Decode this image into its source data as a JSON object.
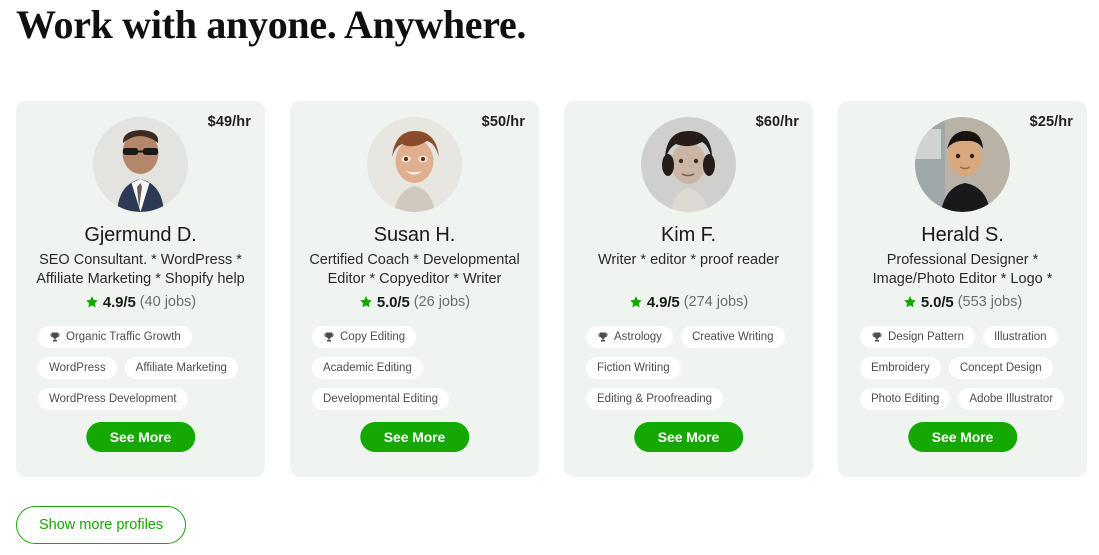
{
  "heading": "Work with anyone. Anywhere.",
  "colors": {
    "accent_green": "#14a800",
    "star_green": "#14a800",
    "card_bg": "#f0f4f0",
    "tag_bg": "#ffffff",
    "text_dark": "#1a1a1a",
    "text_muted": "#6b6f6b"
  },
  "see_more_label": "See More",
  "show_more_label": "Show more profiles",
  "trophy_icon": "trophy-icon",
  "star_icon": "star-icon",
  "cards": [
    {
      "rate": "$49/hr",
      "name": "Gjermund D.",
      "description": "SEO Consultant. * WordPress * Affiliate Marketing * Shopify help",
      "rating": "4.9/5",
      "jobs": "(40 jobs)",
      "avatar": "avatar-gjermund",
      "tag_rows": [
        [
          "Organic Traffic Growth"
        ],
        [
          "WordPress",
          "Affiliate Marketing"
        ],
        [
          "WordPress Development"
        ]
      ]
    },
    {
      "rate": "$50/hr",
      "name": "Susan H.",
      "description": "Certified Coach * Developmental Editor * Copyeditor * Writer",
      "rating": "5.0/5",
      "jobs": "(26 jobs)",
      "avatar": "avatar-susan",
      "tag_rows": [
        [
          "Copy Editing"
        ],
        [
          "Academic Editing"
        ],
        [
          "Developmental Editing"
        ]
      ]
    },
    {
      "rate": "$60/hr",
      "name": "Kim F.",
      "description": "Writer * editor * proof reader",
      "rating": "4.9/5",
      "jobs": "(274 jobs)",
      "avatar": "avatar-kim",
      "tag_rows": [
        [
          "Astrology",
          "Creative Writing"
        ],
        [
          "Fiction Writing"
        ],
        [
          "Editing & Proofreading"
        ]
      ]
    },
    {
      "rate": "$25/hr",
      "name": "Herald S.",
      "description": "Professional Designer * Image/Photo Editor * Logo *",
      "rating": "5.0/5",
      "jobs": "(553 jobs)",
      "avatar": "avatar-herald",
      "tag_rows": [
        [
          "Design Pattern",
          "Illustration"
        ],
        [
          "Embroidery",
          "Concept Design"
        ],
        [
          "Photo Editing",
          "Adobe Illustrator"
        ]
      ]
    }
  ]
}
